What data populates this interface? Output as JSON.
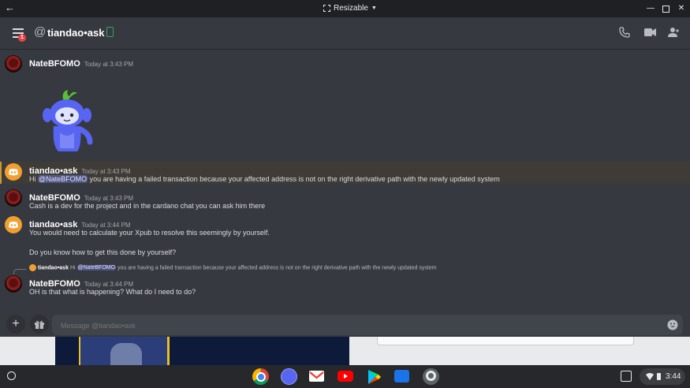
{
  "window": {
    "mode_label": "Resizable"
  },
  "header": {
    "channel_name": "tiandao•ask",
    "notification_badge": "1"
  },
  "messages": [
    {
      "author": "NateBFOMO",
      "time": "Today at 3:43 PM"
    },
    {
      "author": "tiandao•ask",
      "time": "Today at 3:43 PM",
      "prefix": "Hi ",
      "mention": "@NateBFOMO",
      "text": " you are having a failed transaction because your affected address is not on the right derivative path with the newly updated system"
    },
    {
      "author": "NateBFOMO",
      "time": "Today at 3:43 PM",
      "text": "Cash is a dev for the project and in the cardano chat you can ask him there"
    },
    {
      "author": "tiandao•ask",
      "time": "Today at 3:44 PM",
      "text": "You would need to calculate your Xpub to resolve this seemingly by yourself.",
      "text2": "Do you know how to get this done by yourself?"
    },
    {
      "author": "NateBFOMO",
      "time": "Today at 3:44 PM",
      "text": "OH is that what is happening? What do I need to do?",
      "reply": {
        "author": "tiandao•ask",
        "prefix": "Hi ",
        "mention": "@NateBFOMO",
        "text": " you are having a failed transaction because your affected address is not on the right derivative path with the newly updated system"
      }
    }
  ],
  "composer": {
    "placeholder": "Message @tiandao•ask"
  },
  "shelf": {
    "time": "3:44",
    "apps": [
      "chrome-icon",
      "discord-icon",
      "gmail-icon",
      "youtube-icon",
      "play-store-icon",
      "files-icon",
      "settings-icon"
    ]
  },
  "colors": {
    "background": "#36393f",
    "mention_bg": "#4f5585",
    "highlight": "#c99a36",
    "avatar_orange": "#f1a02f",
    "online_green": "#3ba55d"
  }
}
